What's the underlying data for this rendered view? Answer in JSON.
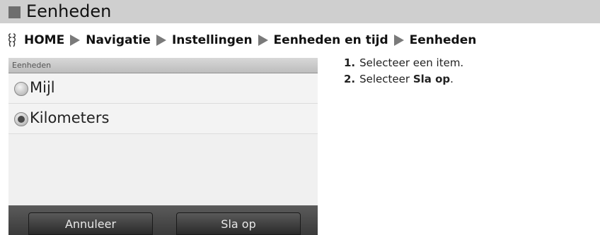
{
  "header": {
    "title": "Eenheden"
  },
  "breadcrumb": {
    "items": [
      "HOME",
      "Navigatie",
      "Instellingen",
      "Eenheden en tijd",
      "Eenheden"
    ]
  },
  "screen": {
    "title": "Eenheden",
    "options": [
      {
        "label": "Mijl",
        "selected": false
      },
      {
        "label": "Kilometers",
        "selected": true
      }
    ],
    "buttons": {
      "cancel": "Annuleer",
      "save": "Sla op"
    }
  },
  "instructions": {
    "step1_num": "1.",
    "step1_text": "Selecteer een item.",
    "step2_num": "2.",
    "step2_text": "Selecteer ",
    "step2_bold": "Sla op",
    "step2_end": "."
  }
}
